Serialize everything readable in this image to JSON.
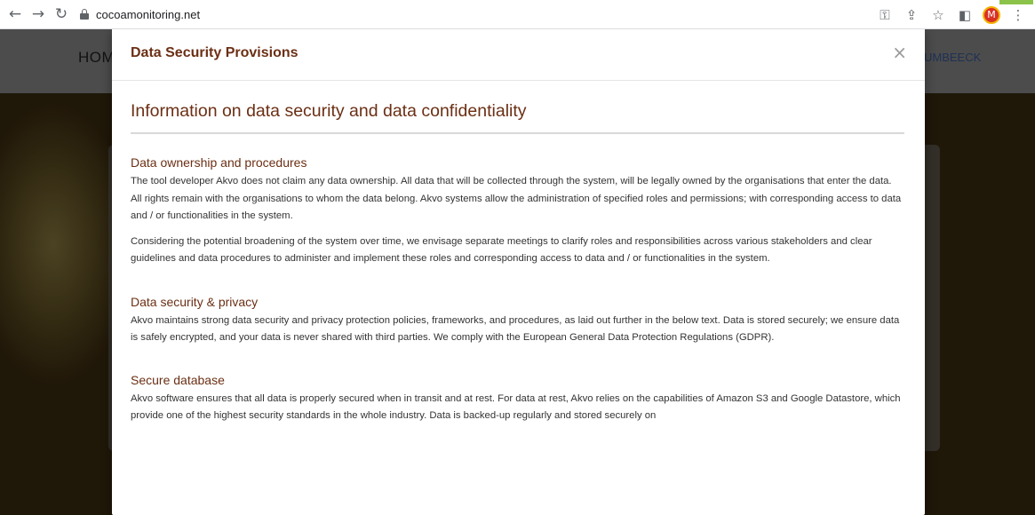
{
  "browser": {
    "url": "cocoamonitoring.net",
    "avatar_initial": "M"
  },
  "site": {
    "nav_left": "HOM",
    "nav_right": "UMBEECK"
  },
  "modal": {
    "title": "Data Security Provisions",
    "close_symbol": "×",
    "heading": "Information on data security and data confidentiality",
    "sections": [
      {
        "title": "Data ownership and procedures",
        "paragraphs": [
          "The tool developer Akvo does not claim any data ownership. All data that will be collected through the system, will be legally owned by the organisations that enter the data. All rights remain with the organisations to whom the data belong. Akvo systems allow the administration of specified roles and permissions; with corresponding access to data and / or functionalities in the system.",
          "Considering the potential broadening of the system over time, we envisage separate meetings to clarify roles and responsibilities across various stakeholders and clear guidelines and data procedures to administer and implement these roles and corresponding access to data and / or functionalities in the system."
        ]
      },
      {
        "title": "Data security & privacy",
        "paragraphs": [
          "Akvo maintains strong data security and privacy protection policies, frameworks, and procedures, as laid out further in the below text. Data is stored securely; we ensure data is safely encrypted, and your data is never shared with third parties. We comply with the European General Data Protection Regulations (GDPR)."
        ]
      },
      {
        "title": "Secure database",
        "paragraphs": [
          "Akvo software ensures that all data is properly secured when in transit and at rest. For data at rest, Akvo relies on the capabilities of Amazon S3 and Google Datastore, which provide one of the highest security standards in the whole industry. Data is backed-up regularly and stored securely on"
        ]
      }
    ]
  }
}
